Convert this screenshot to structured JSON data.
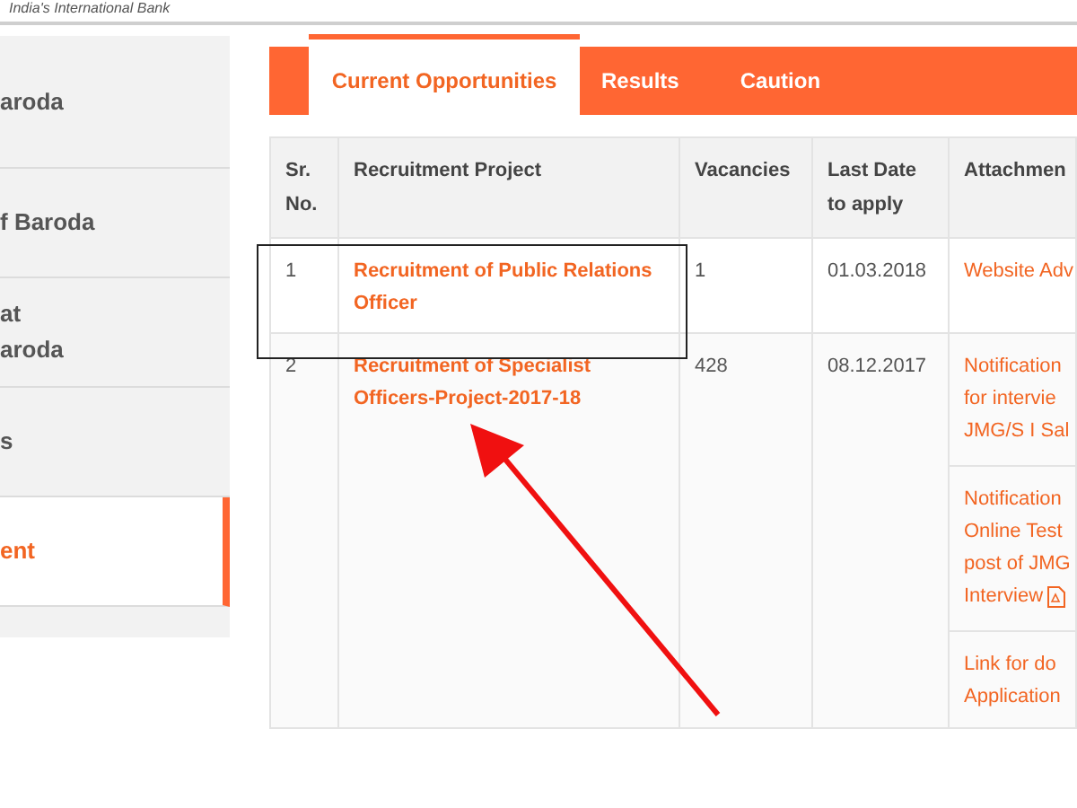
{
  "header": {
    "tagline": "India's International Bank"
  },
  "sidebar": {
    "items": [
      {
        "lines": [
          "aroda"
        ],
        "selected": false
      },
      {
        "lines": [
          "f Baroda"
        ],
        "selected": false
      },
      {
        "lines": [
          "at",
          "aroda"
        ],
        "selected": false
      },
      {
        "lines": [
          "s"
        ],
        "selected": false
      },
      {
        "lines": [
          "ent"
        ],
        "selected": true
      }
    ]
  },
  "tabs": [
    {
      "label": "Current Opportunities",
      "selected": true
    },
    {
      "label": "Results",
      "selected": false
    },
    {
      "label": "Caution",
      "selected": false
    }
  ],
  "table": {
    "columns": [
      {
        "lines": [
          "Sr.",
          "No."
        ]
      },
      {
        "lines": [
          "Recruitment Project"
        ]
      },
      {
        "lines": [
          "Vacancies"
        ]
      },
      {
        "lines": [
          "Last Date",
          "to apply"
        ]
      },
      {
        "lines": [
          "Attachmen"
        ]
      }
    ],
    "rows": [
      {
        "sr": "1",
        "project": [
          "Recruitment of Public Relations",
          "Officer"
        ],
        "vacancies": "1",
        "last_date": "01.03.2018",
        "attachments": [
          {
            "kind": "link",
            "lines": [
              "Website Adv"
            ]
          }
        ]
      },
      {
        "sr": "2",
        "project": [
          "Recruitment of Specialist",
          "Officers-Project-2017-18"
        ],
        "vacancies": "428",
        "last_date": "08.12.2017",
        "attachments": [
          {
            "kind": "link",
            "lines": [
              "Notification",
              "for intervie",
              "JMG/S I Sal"
            ]
          },
          {
            "kind": "pdf-link",
            "lines": [
              "Notification",
              "Online Test",
              "post of JMG",
              "Interview"
            ]
          },
          {
            "kind": "link",
            "lines": [
              "Link for do",
              "Application"
            ]
          }
        ]
      }
    ]
  }
}
